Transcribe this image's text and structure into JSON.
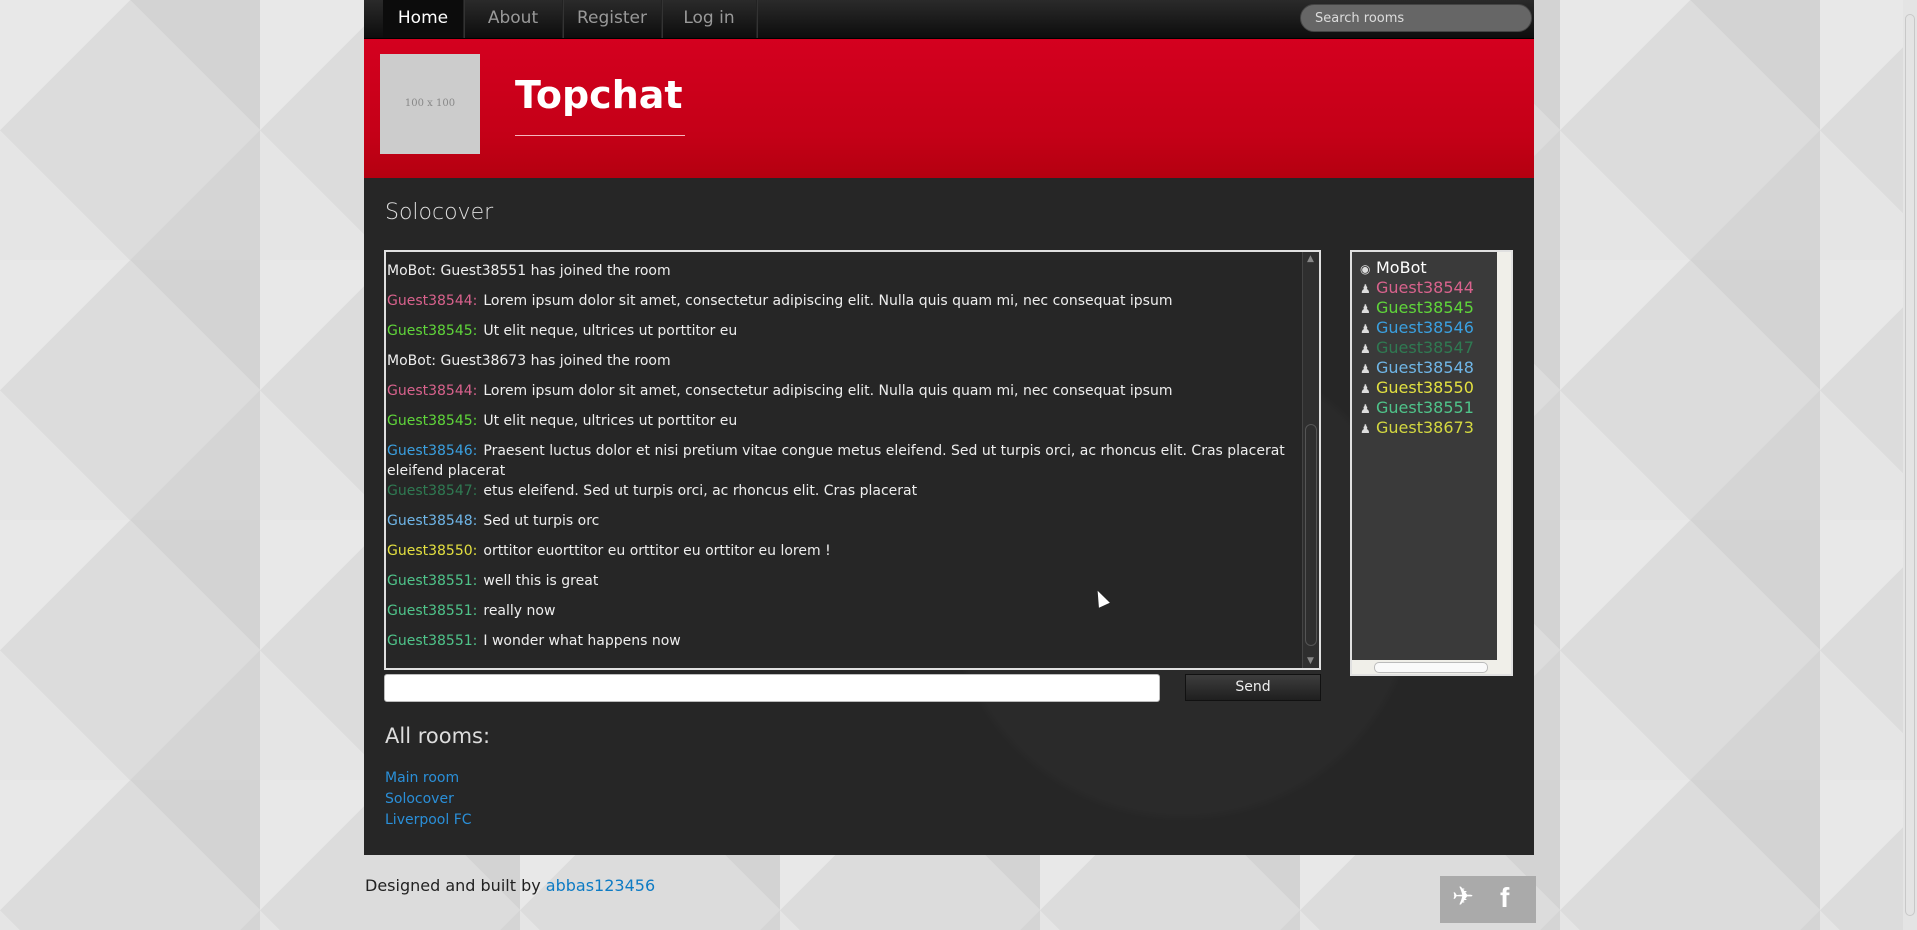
{
  "nav": {
    "items": [
      {
        "label": "Home",
        "active": true
      },
      {
        "label": "About",
        "active": false
      },
      {
        "label": "Register",
        "active": false
      },
      {
        "label": "Log in",
        "active": false
      }
    ],
    "search_placeholder": "Search rooms"
  },
  "header": {
    "logo_text": "100 x 100",
    "brand": "Topchat"
  },
  "room": {
    "title": "Solocover",
    "messages": [
      {
        "user": "",
        "text": "MoBot: Guest38551 has joined the room",
        "color": "#eeeeee"
      },
      {
        "user": "Guest38544:",
        "text": "Lorem ipsum dolor sit amet, consectetur adipiscing elit. Nulla quis quam mi, nec consequat ipsum",
        "color": "#d9628d"
      },
      {
        "user": "Guest38545:",
        "text": "Ut elit neque, ultrices ut porttitor eu",
        "color": "#5fd63a"
      },
      {
        "user": "",
        "text": "MoBot: Guest38673 has joined the room",
        "color": "#eeeeee"
      },
      {
        "user": "Guest38544:",
        "text": "Lorem ipsum dolor sit amet, consectetur adipiscing elit. Nulla quis quam mi, nec consequat ipsum",
        "color": "#d9628d"
      },
      {
        "user": "Guest38545:",
        "text": "Ut elit neque, ultrices ut porttitor eu",
        "color": "#5fd63a"
      },
      {
        "user": "Guest38546:",
        "text": "Praesent luctus dolor et nisi pretium vitae congue metus eleifend. Sed ut turpis orci, ac rhoncus elit. Cras placerat eleifend placerat",
        "color": "#3aa0e0"
      },
      {
        "user": "Guest38547:",
        "text": "etus eleifend. Sed ut turpis orci, ac rhoncus elit. Cras placerat",
        "color": "#2f7a52"
      },
      {
        "user": "Guest38548:",
        "text": "Sed ut turpis orc",
        "color": "#6fb6e8"
      },
      {
        "user": "Guest38550:",
        "text": "orttitor euorttitor eu orttitor eu orttitor eu lorem !",
        "color": "#e3e040"
      },
      {
        "user": "Guest38551:",
        "text": "well this is great",
        "color": "#4fc48a"
      },
      {
        "user": "Guest38551:",
        "text": "really now",
        "color": "#4fc48a"
      },
      {
        "user": "Guest38551:",
        "text": "I wonder what happens now",
        "color": "#4fc48a"
      }
    ],
    "users": [
      {
        "name": "MoBot",
        "icon": "eye-icon",
        "color": "#ffffff"
      },
      {
        "name": "Guest38544",
        "icon": "user-icon",
        "color": "#d9628d"
      },
      {
        "name": "Guest38545",
        "icon": "user-icon",
        "color": "#5fd63a"
      },
      {
        "name": "Guest38546",
        "icon": "user-icon",
        "color": "#3aa0e0"
      },
      {
        "name": "Guest38547",
        "icon": "user-icon",
        "color": "#2f7a52"
      },
      {
        "name": "Guest38548",
        "icon": "user-icon",
        "color": "#6fb6e8"
      },
      {
        "name": "Guest38550",
        "icon": "user-icon",
        "color": "#e3e040"
      },
      {
        "name": "Guest38551",
        "icon": "user-icon",
        "color": "#4fc48a"
      },
      {
        "name": "Guest38673",
        "icon": "user-icon",
        "color": "#d4d840"
      }
    ],
    "send_label": "Send"
  },
  "all_rooms": {
    "heading": "All rooms:",
    "links": [
      "Main room",
      "Solocover",
      "Liverpool FC"
    ]
  },
  "footer": {
    "text": "Designed and built by",
    "author": "abbas123456",
    "social": [
      {
        "icon": "twitter-icon"
      },
      {
        "icon": "facebook-icon"
      }
    ]
  }
}
